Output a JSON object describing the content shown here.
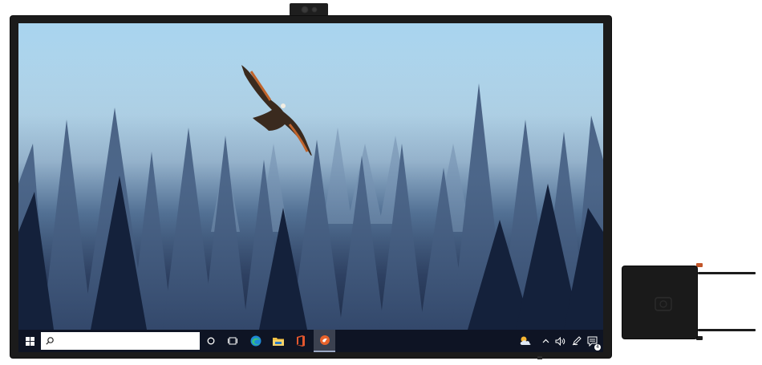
{
  "screen": {
    "wallpaper": "forest-with-hawk",
    "colors": {
      "sky": "#b9dcef",
      "forest": "#1f2f50",
      "taskbar": "#0e1424"
    }
  },
  "taskbar": {
    "start_icon": "windows-logo-icon",
    "search": {
      "icon": "search-icon",
      "placeholder": "",
      "value": ""
    },
    "pinned_apps": [
      {
        "name": "cortana",
        "icon": "cortana-circle-icon"
      },
      {
        "name": "task-view",
        "icon": "task-view-icon"
      },
      {
        "name": "edge",
        "icon": "edge-icon"
      },
      {
        "name": "file-explorer",
        "icon": "folder-icon"
      },
      {
        "name": "office",
        "icon": "office-icon"
      },
      {
        "name": "whiteboard",
        "icon": "app-orange-icon",
        "active": true
      }
    ],
    "tray": {
      "weather_icon": "weather-cloud-sun-icon",
      "overflow_icon": "chevron-up-icon",
      "volume_icon": "speaker-icon",
      "pen_icon": "pen-icon",
      "notifications_icon": "notification-icon",
      "notification_count": "4"
    }
  },
  "device": {
    "camera_icon": "camera-icon",
    "compute_box_logo": "brand-logo-icon"
  }
}
